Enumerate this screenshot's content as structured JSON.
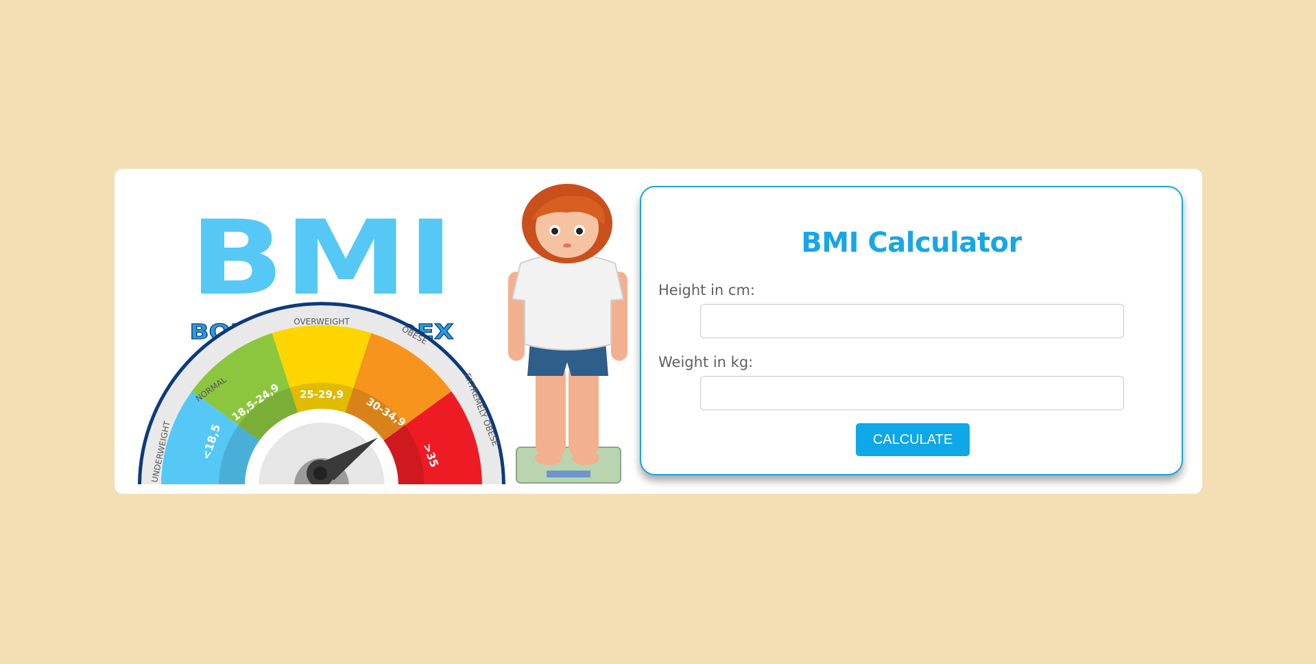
{
  "illustration": {
    "big_title": "BMI",
    "subtitle": "BODY MASS INDEX",
    "gauge": {
      "segments": [
        {
          "label": "UNDERWEIGHT",
          "range": "<18,5",
          "color": "#55c8f5"
        },
        {
          "label": "NORMAL",
          "range": "18,5-24,9",
          "color": "#8cc63f"
        },
        {
          "label": "OVERWEIGHT",
          "range": "25-29,9",
          "color": "#ffd500"
        },
        {
          "label": "OBESE",
          "range": "30-34,9",
          "color": "#f7941d"
        },
        {
          "label": "EXTREMELY OBESE",
          "range": ">35",
          "color": "#ed1c24"
        }
      ]
    }
  },
  "form": {
    "title": "BMI Calculator",
    "height_label": "Height in cm:",
    "height_value": "",
    "weight_label": "Weight in kg:",
    "weight_value": "",
    "button_label": "CALCULATE"
  },
  "colors": {
    "background": "#f4deb3",
    "accent": "#17a6e6",
    "button": "#0ea7e8"
  }
}
